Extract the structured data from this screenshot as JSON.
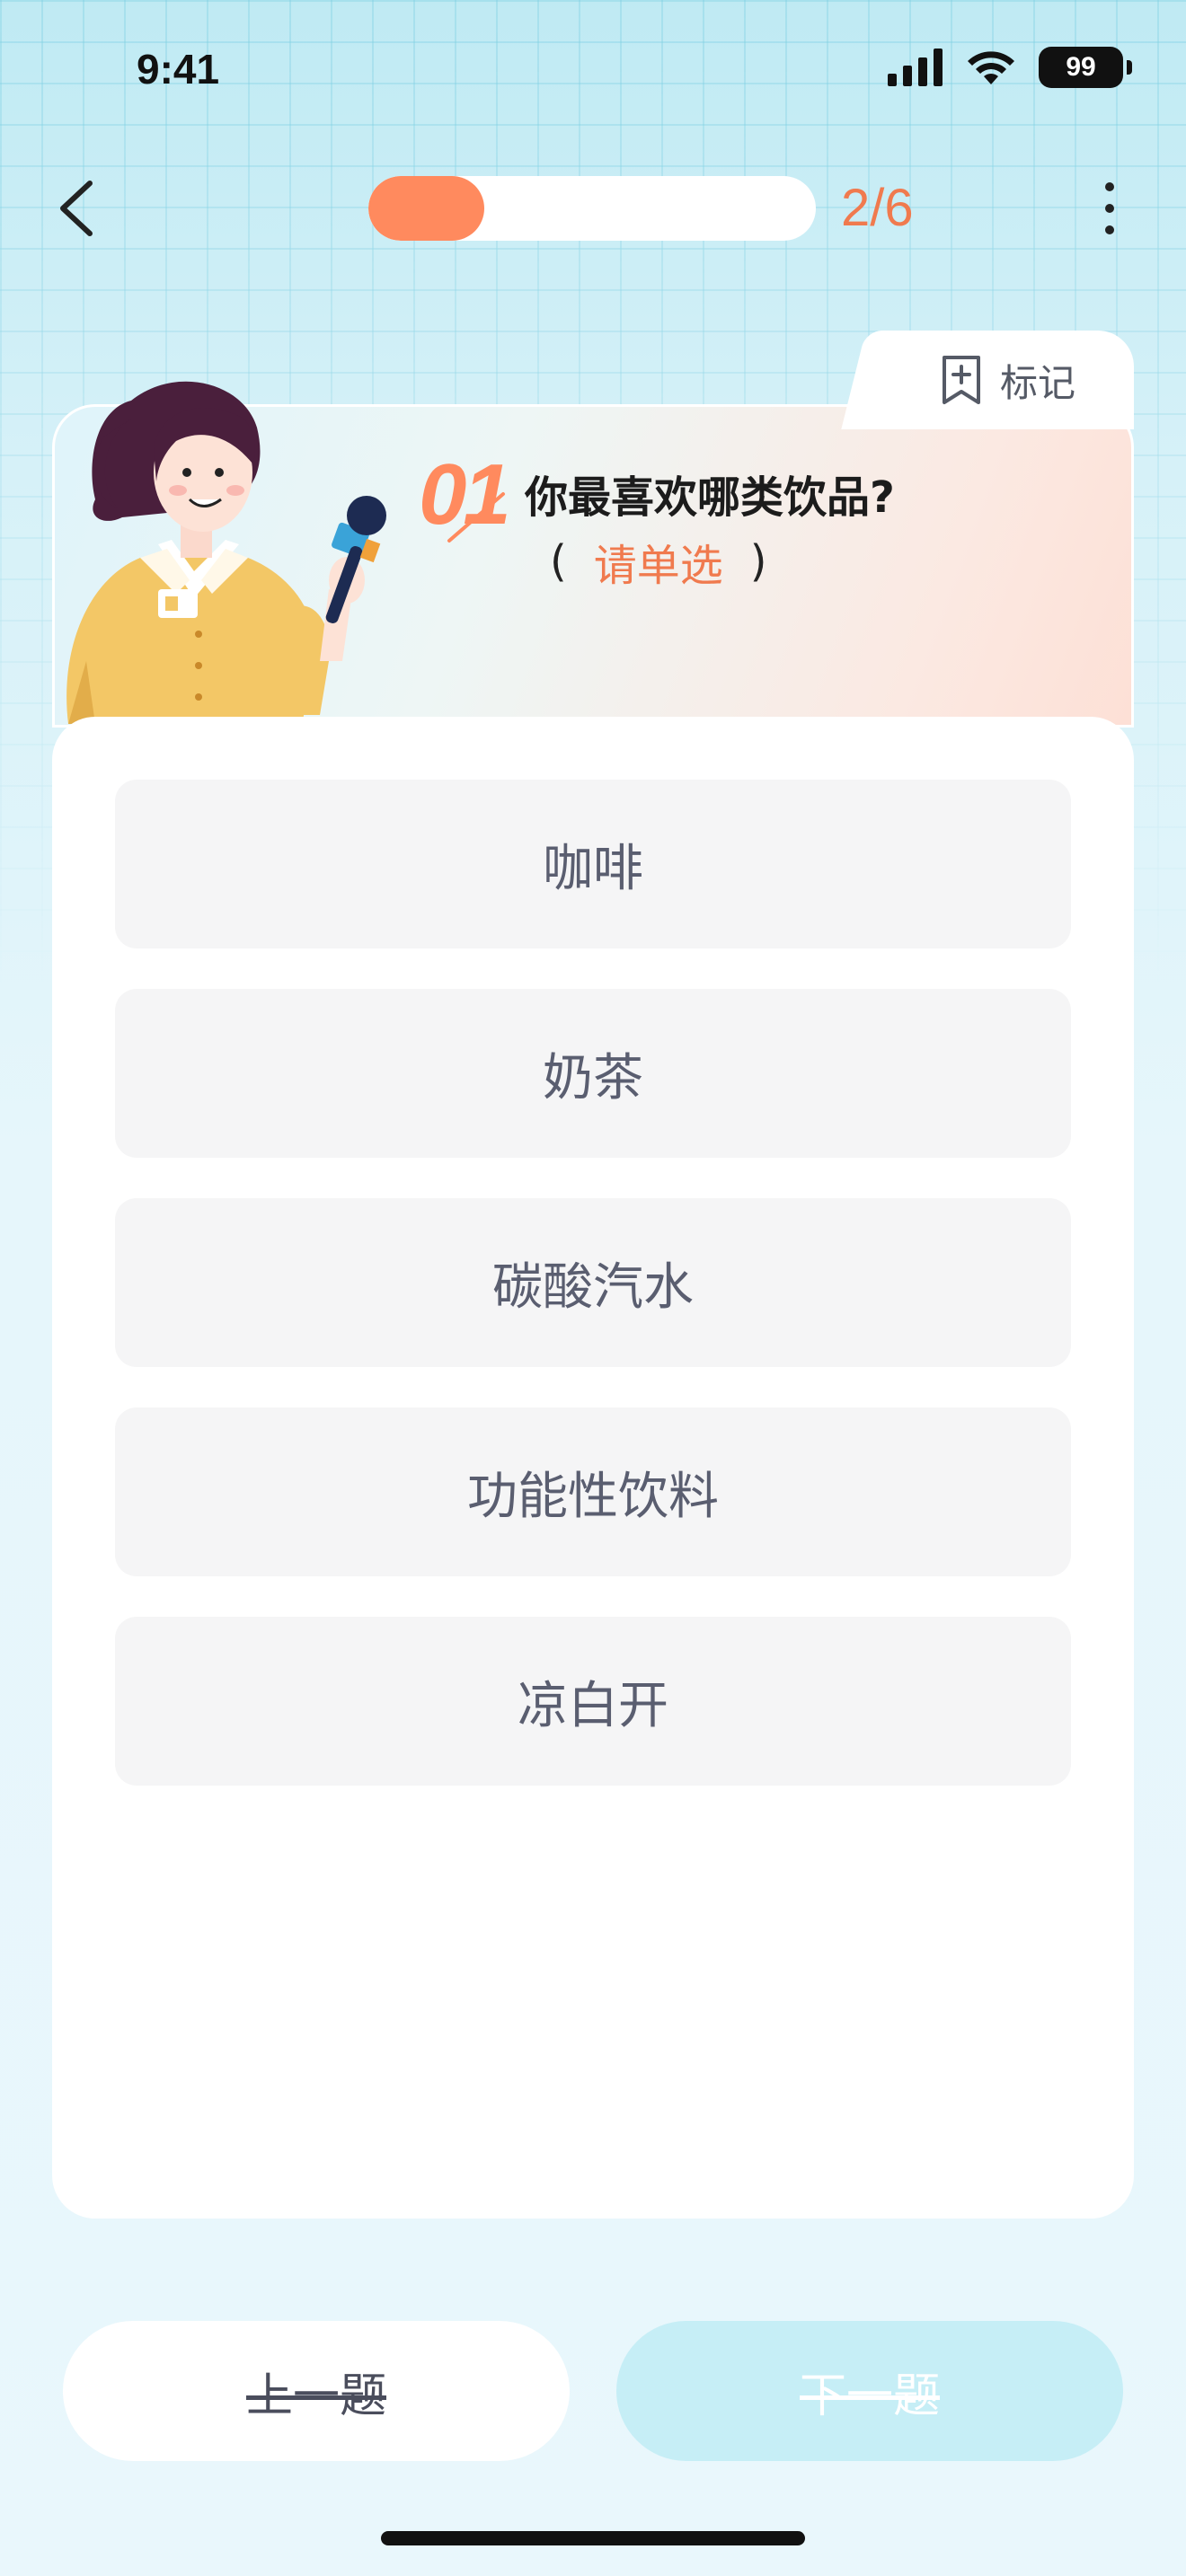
{
  "status_bar": {
    "time": "9:41",
    "battery": "99"
  },
  "progress": {
    "count_text": "2/6",
    "fill_fraction": 0.26
  },
  "header": {
    "mark_label": "标记"
  },
  "question": {
    "number": "01",
    "title": "你最喜欢哪类饮品?",
    "hint_open": "(",
    "hint": "请单选",
    "hint_close": ")"
  },
  "options": [
    {
      "label": "咖啡"
    },
    {
      "label": "奶茶"
    },
    {
      "label": "碳酸汽水"
    },
    {
      "label": "功能性饮料"
    },
    {
      "label": "凉白开"
    }
  ],
  "footer": {
    "prev_label": "上一题",
    "next_label": "下一题"
  },
  "colors": {
    "accent": "#ff8a5e",
    "next_button": "#c6eef6"
  },
  "icons": [
    "back-arrow-icon",
    "more-vertical-icon",
    "bookmark-add-icon",
    "signal-icon",
    "wifi-icon",
    "battery-icon"
  ]
}
